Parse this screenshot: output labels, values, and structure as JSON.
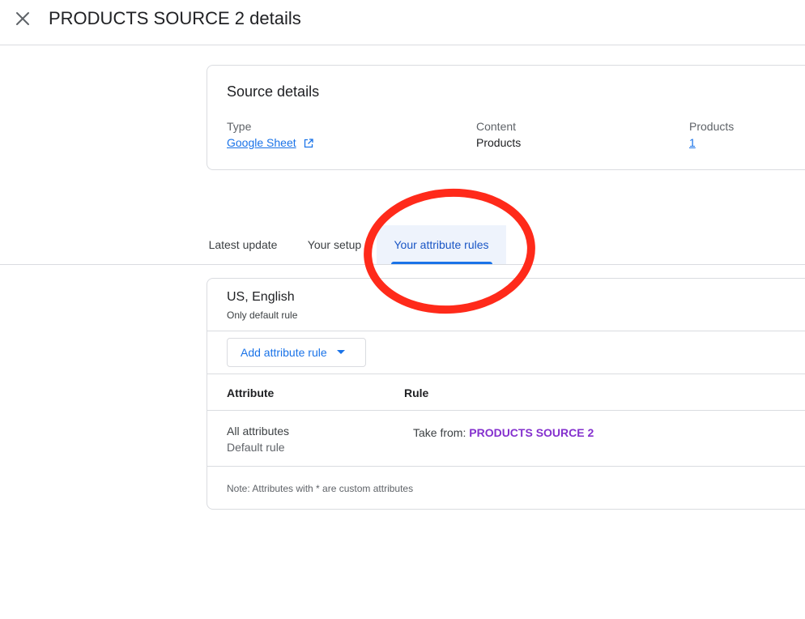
{
  "header": {
    "title": "PRODUCTS SOURCE 2 details",
    "close_icon": "close-icon"
  },
  "source_details": {
    "title": "Source details",
    "type_label": "Type",
    "type_value": "Google Sheet",
    "type_icon": "open-in-new-icon",
    "content_label": "Content",
    "content_value": "Products",
    "products_label": "Products",
    "products_value": "1"
  },
  "tabs": [
    {
      "label": "Latest update"
    },
    {
      "label": "Your setup"
    },
    {
      "label": "Your attribute rules",
      "active": true
    }
  ],
  "rules": {
    "title": "US, English",
    "subtitle": "Only default rule",
    "add_button_label": "Add attribute rule",
    "add_button_icon": "arrow-drop-down-icon",
    "headers": {
      "attribute": "Attribute",
      "rule": "Rule"
    },
    "rows": [
      {
        "attribute": "All attributes",
        "sub": "Default rule",
        "rule_prefix": "Take from:",
        "rule_source": "PRODUCTS SOURCE 2"
      }
    ],
    "note": "Note: Attributes with * are custom attributes"
  },
  "colors": {
    "accent": "#1a73e8",
    "source_purple": "#8430ce",
    "annotation_red": "#ff2a1a"
  }
}
